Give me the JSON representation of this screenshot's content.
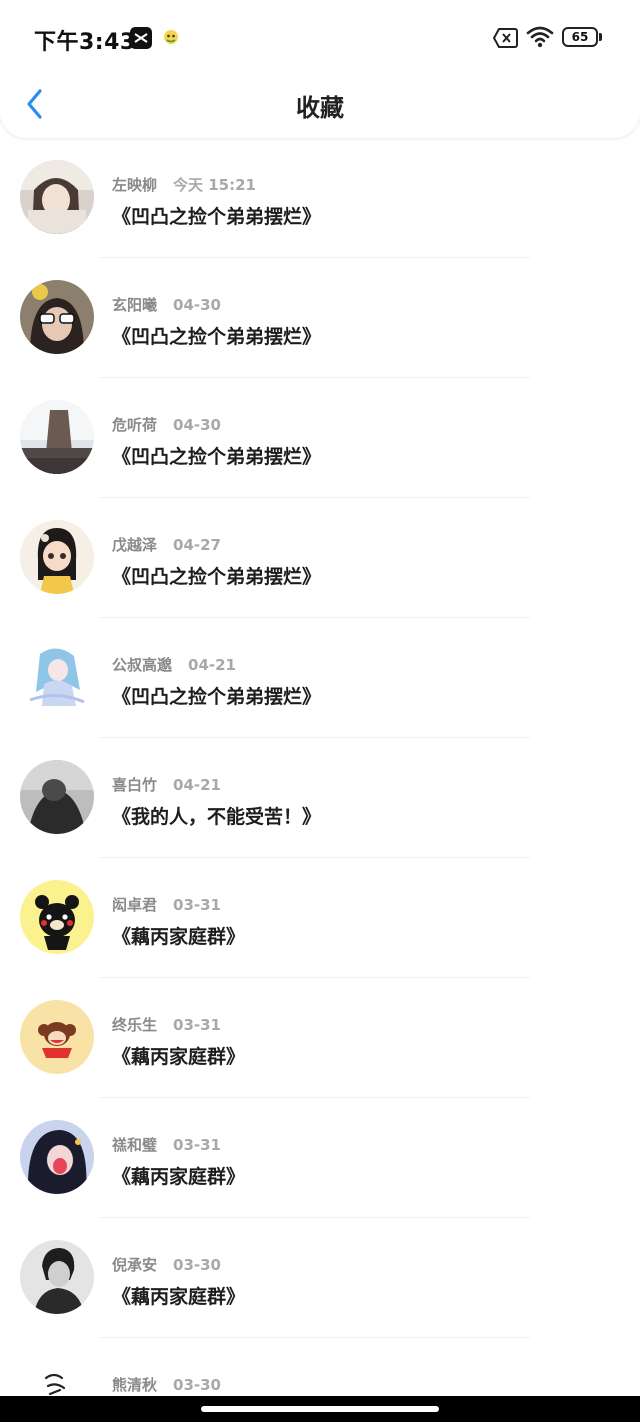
{
  "status_bar": {
    "time": "下午3:43",
    "battery": "65"
  },
  "header": {
    "title": "收藏"
  },
  "items": [
    {
      "name": "左映柳",
      "time": "今天 15:21",
      "title": "《凹凸之捡个弟弟摆烂》"
    },
    {
      "name": "玄阳曦",
      "time": "04-30",
      "title": "《凹凸之捡个弟弟摆烂》"
    },
    {
      "name": "危听荷",
      "time": "04-30",
      "title": "《凹凸之捡个弟弟摆烂》"
    },
    {
      "name": "戊越泽",
      "time": "04-27",
      "title": "《凹凸之捡个弟弟摆烂》"
    },
    {
      "name": "公叔高邈",
      "time": "04-21",
      "title": "《凹凸之捡个弟弟摆烂》"
    },
    {
      "name": "喜白竹",
      "time": "04-21",
      "title": "《我的人，不能受苦！》"
    },
    {
      "name": "闳卓君",
      "time": "03-31",
      "title": "《藕丙家庭群》"
    },
    {
      "name": "终乐生",
      "time": "03-31",
      "title": "《藕丙家庭群》"
    },
    {
      "name": "禚和璧",
      "time": "03-31",
      "title": "《藕丙家庭群》"
    },
    {
      "name": "倪承安",
      "time": "03-30",
      "title": "《藕丙家庭群》"
    },
    {
      "name": "熊清秋",
      "time": "03-30",
      "title": ""
    }
  ],
  "colors": {
    "accent": "#2a8cf0",
    "name_gray": "#8a8a8a",
    "title_dark": "#1e1e1e"
  }
}
